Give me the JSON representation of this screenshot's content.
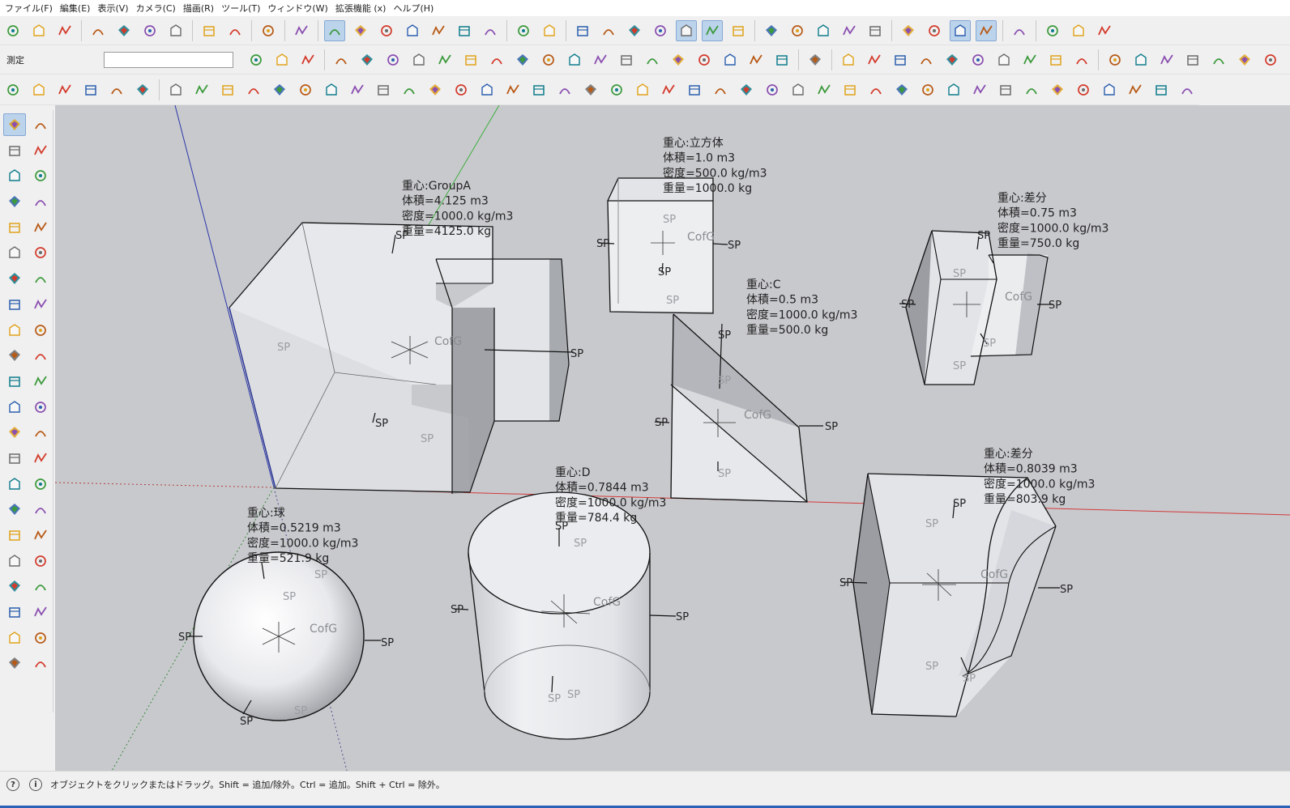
{
  "menu": [
    "ファイル(F)",
    "編集(E)",
    "表示(V)",
    "カメラ(C)",
    "描画(R)",
    "ツール(T)",
    "ウィンドウ(W)",
    "拡張機能 (x)",
    "ヘルプ(H)"
  ],
  "measurements": {
    "label": "測定",
    "value": ""
  },
  "toolbar1": [
    "new-file",
    "open",
    "save",
    "|",
    "cut",
    "copy",
    "paste",
    "delete",
    "|",
    "undo",
    "redo",
    "|",
    "print",
    "|",
    "model-info",
    "|",
    "iso-view",
    "top-view",
    "front-view",
    "right-view",
    "back-view",
    "left-view",
    "bottom-view",
    "|",
    "component",
    "paint",
    "|",
    "xray",
    "back-edges",
    "wireframe",
    "hidden-line",
    "shaded",
    "shaded-texture",
    "monochrome",
    "|",
    "union",
    "outer-shell",
    "intersect",
    "subtract",
    "trim",
    "|",
    "section-plane",
    "section-display",
    "section-cut",
    "section-fill",
    "|",
    "spring",
    "|",
    "shadow",
    "fog",
    "star"
  ],
  "toolbar2": [
    "select-extra",
    "report",
    "outliner",
    "|",
    "bezier",
    "polyline",
    "freehand",
    "curve",
    "arc-tool",
    "arc-2pt",
    "rectangle",
    "circle",
    "arc-3pt",
    "wave",
    "arc-pie",
    "bend",
    "spiral",
    "segment",
    "polygon",
    "wrench",
    "circle-ellipse",
    "triangle",
    "|",
    "arch",
    "|",
    "surface-1",
    "surface-2",
    "surface-3",
    "surface-4",
    "surface-5",
    "surface-6",
    "surface-7",
    "surface-8",
    "surface-9",
    "surface-10",
    "|",
    "panel-blue",
    "panel-yellow",
    "film",
    "tree",
    "lamp",
    "cone",
    "blue-chip"
  ],
  "toolbar3": [
    "layer-red",
    "layer-blue",
    "layer-yellow",
    "layer-green",
    "layer-red2",
    "layer-stack",
    "|",
    "curl-1",
    "curl-2",
    "curl-3",
    "box-orange",
    "grid-red",
    "flag",
    "block-brown",
    "pipe",
    "hook",
    "dots-red",
    "dots-blue",
    "plus-red",
    "plus-green",
    "x-blue",
    "grid-dots",
    "cone-blue",
    "drop",
    "warning",
    "loop-1",
    "loop-2",
    "loop-3",
    "star4",
    "bucket",
    "undo-red",
    "puzzle",
    "box-3d",
    "boxes-red",
    "boxes-red2",
    "gem",
    "boxes-grid",
    "box-teal",
    "box-dark",
    "box-red",
    "box-green",
    "grid-orange",
    "grid-orange2",
    "grid-orange3",
    "x-red",
    "circle-dots",
    "grid-plus"
  ],
  "lefttools": [
    "select",
    "lasso",
    "paint-bucket",
    "eraser",
    "components",
    "tag",
    "pencil",
    "freehand",
    "rectangle",
    "rotated-rect",
    "circle",
    "polygon",
    "arc",
    "arc-2pt",
    "pie",
    "arc-3pt",
    "move",
    "push-pull",
    "rotate",
    "follow-me",
    "scale",
    "offset",
    "explode",
    "mirror",
    "tape-measure",
    "dimension",
    "protractor",
    "text",
    "axes",
    "3d-text",
    "section",
    "pan-hand",
    "zoom",
    "zoom-window",
    "zoom-extents",
    "zoom-previous",
    "position-camera",
    "walk",
    "look-around",
    "look-scene",
    "sandbox-1",
    "sandbox-2",
    "sandbox-3",
    "sandbox-4"
  ],
  "scene": {
    "origin_label": "",
    "objects": [
      {
        "name": "GroupA",
        "labels": [
          "重心:GroupA",
          "体積=4.125 m3",
          "密度=1000.0 kg/m3",
          "重量=4125.0 kg"
        ],
        "cofg": "CofG",
        "sp": "SP"
      },
      {
        "name": "立方体",
        "labels": [
          "重心:立方体",
          "体積=1.0 m3",
          "密度=500.0 kg/m3",
          "重量=1000.0 kg"
        ],
        "cofg": "CofG",
        "sp": "SP"
      },
      {
        "name": "C",
        "labels": [
          "重心:C",
          "体積=0.5 m3",
          "密度=1000.0 kg/m3",
          "重量=500.0 kg"
        ],
        "cofg": "CofG",
        "sp": "SP"
      },
      {
        "name": "差分1",
        "labels": [
          "重心:差分",
          "体積=0.75 m3",
          "密度=1000.0 kg/m3",
          "重量=750.0 kg"
        ],
        "cofg": "CofG",
        "sp": "SP"
      },
      {
        "name": "球",
        "labels": [
          "重心:球",
          "体積=0.5219 m3",
          "密度=1000.0 kg/m3",
          "重量=521.9 kg"
        ],
        "cofg": "CofG",
        "sp": "SP"
      },
      {
        "name": "D",
        "labels": [
          "重心:D",
          "体積=0.7844 m3",
          "密度=1000.0 kg/m3",
          "重量=784.4 kg"
        ],
        "cofg": "CofG",
        "sp": "SP"
      },
      {
        "name": "差分2",
        "labels": [
          "重心:差分",
          "体積=0.8039 m3",
          "密度=1000.0 kg/m3",
          "重量=803.9 kg"
        ],
        "cofg": "CofG",
        "sp": "SP"
      }
    ]
  },
  "status": {
    "text": "オブジェクトをクリックまたはドラッグ。Shift = 追加/除外。Ctrl = 追加。Shift + Ctrl = 除外。"
  },
  "colors": {
    "viewport_bg": "#c8c9cd",
    "axis_red": "#d23a3a",
    "axis_green": "#3fae3f",
    "axis_blue": "#2a36a8",
    "selection": "#bcd3ec",
    "face": "#e4e6ea"
  }
}
